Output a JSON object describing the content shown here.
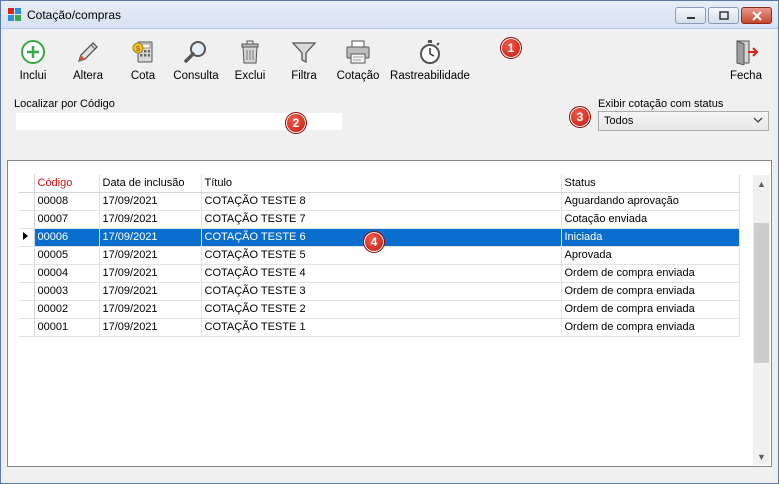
{
  "window": {
    "title": "Cotação/compras",
    "minimize_icon": "minimize-icon",
    "maximize_icon": "maximize-icon",
    "close_icon": "close-icon"
  },
  "toolbar": {
    "items": [
      {
        "label": "Inclui",
        "icon": "plus-circle-icon"
      },
      {
        "label": "Altera",
        "icon": "pencil-icon"
      },
      {
        "label": "Cota",
        "icon": "calculator-coin-icon"
      },
      {
        "label": "Consulta",
        "icon": "magnifier-icon"
      },
      {
        "label": "Exclui",
        "icon": "trash-icon"
      },
      {
        "label": "Filtra",
        "icon": "funnel-icon"
      },
      {
        "label": "Cotação",
        "icon": "printer-icon"
      },
      {
        "label": "Rastreabilidade",
        "icon": "stopwatch-icon"
      }
    ],
    "close_label": "Fecha",
    "close_icon": "exit-door-icon"
  },
  "search": {
    "label": "Localizar por Código",
    "value": "",
    "placeholder": ""
  },
  "status_filter": {
    "label": "Exibir cotação com status",
    "selected": "Todos"
  },
  "badges": [
    "1",
    "2",
    "3",
    "4"
  ],
  "grid": {
    "columns": [
      "Código",
      "Data de inclusão",
      "Título",
      "Status"
    ],
    "rows": [
      {
        "codigo": "00008",
        "data": "17/09/2021",
        "titulo": "COTAÇÃO TESTE 8",
        "status": "Aguardando aprovação"
      },
      {
        "codigo": "00007",
        "data": "17/09/2021",
        "titulo": "COTAÇÃO TESTE 7",
        "status": "Cotação enviada"
      },
      {
        "codigo": "00006",
        "data": "17/09/2021",
        "titulo": "COTAÇÃO TESTE 6",
        "status": "Iniciada"
      },
      {
        "codigo": "00005",
        "data": "17/09/2021",
        "titulo": "COTAÇÃO TESTE 5",
        "status": "Aprovada"
      },
      {
        "codigo": "00004",
        "data": "17/09/2021",
        "titulo": "COTAÇÃO TESTE 4",
        "status": "Ordem de compra enviada"
      },
      {
        "codigo": "00003",
        "data": "17/09/2021",
        "titulo": "COTAÇÃO TESTE 3",
        "status": "Ordem de compra enviada"
      },
      {
        "codigo": "00002",
        "data": "17/09/2021",
        "titulo": "COTAÇÃO TESTE 2",
        "status": "Ordem de compra enviada"
      },
      {
        "codigo": "00001",
        "data": "17/09/2021",
        "titulo": "COTAÇÃO TESTE 1",
        "status": "Ordem de compra enviada"
      }
    ],
    "selected_index": 2
  },
  "colors": {
    "selection": "#0a6ecf",
    "sorted_header": "#c81414",
    "badge": "#d9261a"
  }
}
